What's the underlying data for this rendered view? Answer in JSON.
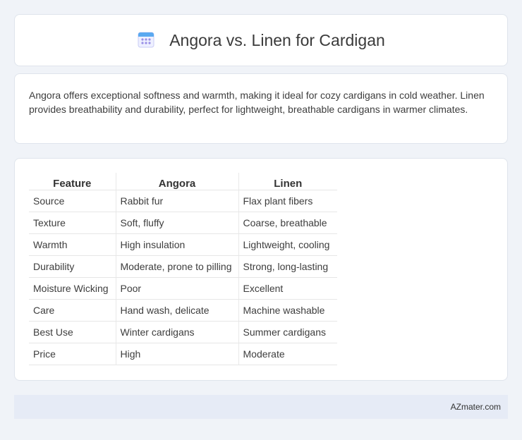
{
  "header": {
    "title": "Angora vs. Linen for Cardigan",
    "icon": "calendar-icon"
  },
  "summary": {
    "text": "Angora offers exceptional softness and warmth, making it ideal for cozy cardigans in cold weather. Linen provides breathability and durability, perfect for lightweight, breathable cardigans in warmer climates."
  },
  "table": {
    "headers": [
      "Feature",
      "Angora",
      "Linen"
    ],
    "rows": [
      [
        "Source",
        "Rabbit fur",
        "Flax plant fibers"
      ],
      [
        "Texture",
        "Soft, fluffy",
        "Coarse, breathable"
      ],
      [
        "Warmth",
        "High insulation",
        "Lightweight, cooling"
      ],
      [
        "Durability",
        "Moderate, prone to pilling",
        "Strong, long-lasting"
      ],
      [
        "Moisture Wicking",
        "Poor",
        "Excellent"
      ],
      [
        "Care",
        "Hand wash, delicate",
        "Machine washable"
      ],
      [
        "Best Use",
        "Winter cardigans",
        "Summer cardigans"
      ],
      [
        "Price",
        "High",
        "Moderate"
      ]
    ]
  },
  "footer": {
    "brand": "AZmater.com"
  },
  "colors": {
    "background": "#f0f3f8",
    "card": "#ffffff",
    "footer": "#e6ebf6",
    "icon_accent": "#7b7fe0"
  }
}
